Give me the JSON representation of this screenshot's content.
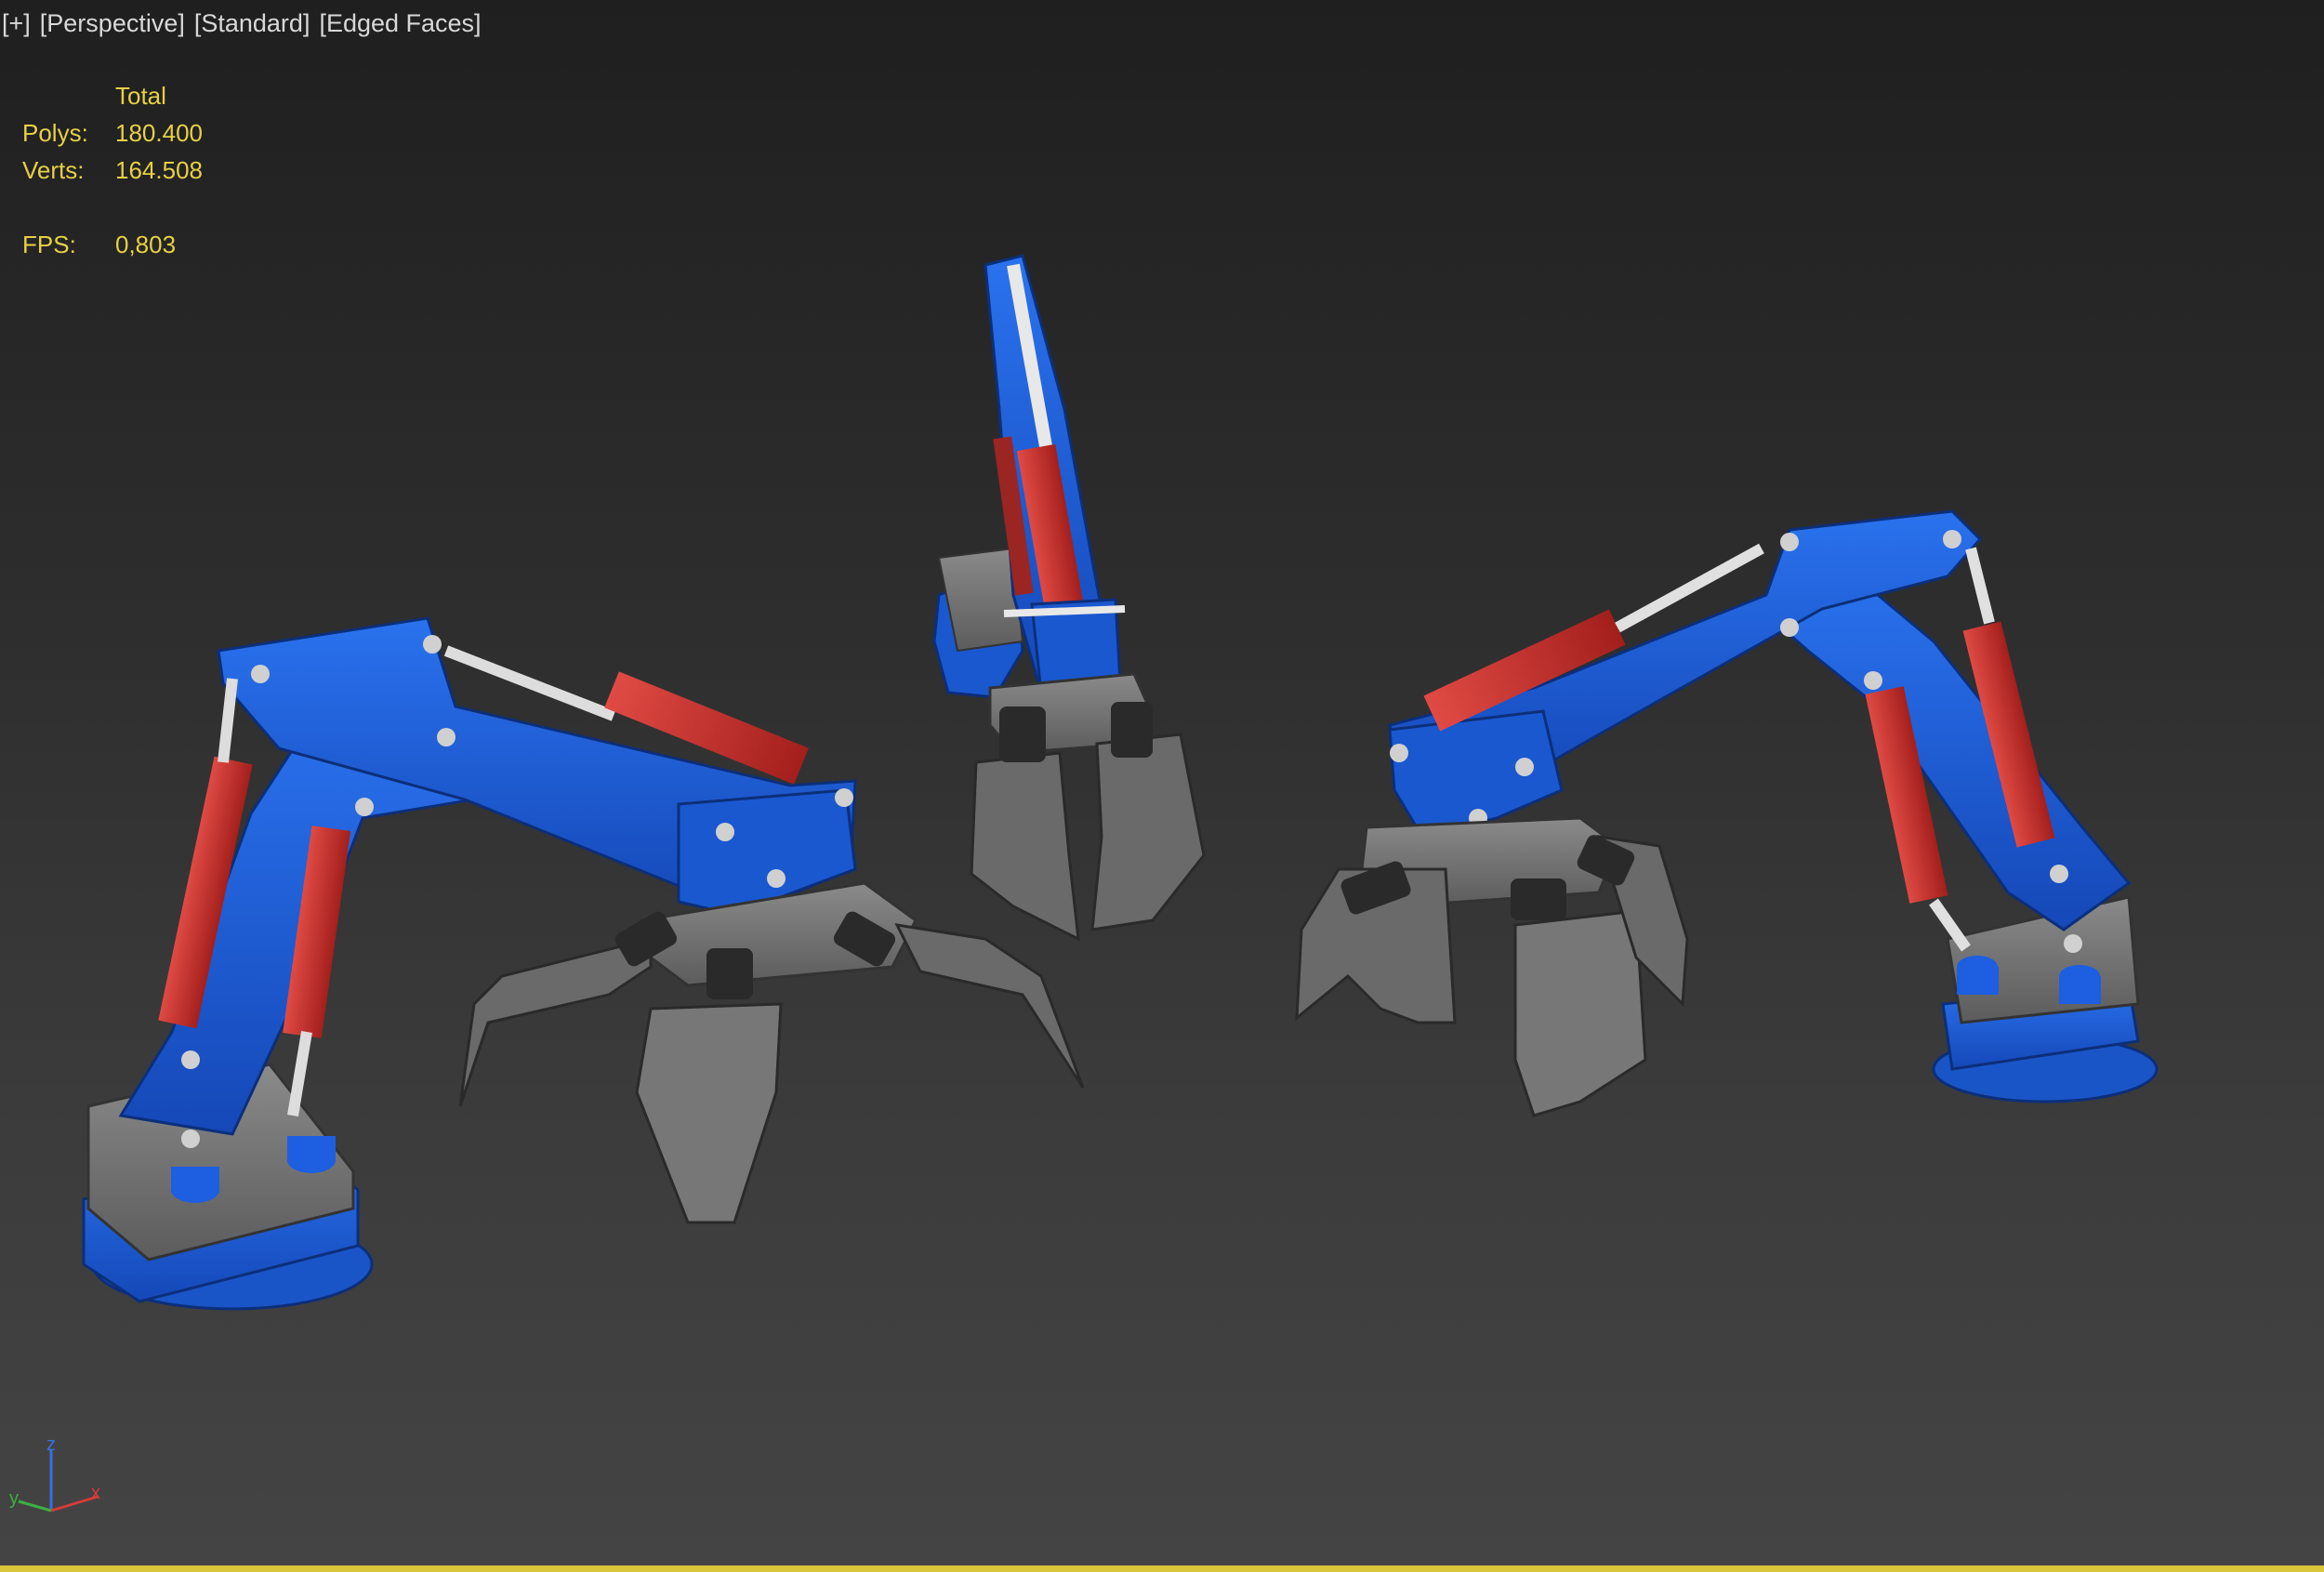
{
  "viewport": {
    "labels": [
      "[+]",
      "[Perspective]",
      "[Standard]",
      "[Edged Faces]"
    ]
  },
  "stats": {
    "header": "Total",
    "polys_label": "Polys:",
    "polys_value": "180.400",
    "verts_label": "Verts:",
    "verts_value": "164.508",
    "fps_label": "FPS:",
    "fps_value": "0,803"
  },
  "colors": {
    "accent_border": "#d9c63a",
    "stats_text": "#e6d045",
    "arm_blue": "#1f5fd6",
    "cylinder_red": "#c9302c",
    "claw_gray": "#6f6f6f"
  },
  "gizmo": {
    "z_label": "z",
    "y_label": "y",
    "x_label": "x"
  }
}
